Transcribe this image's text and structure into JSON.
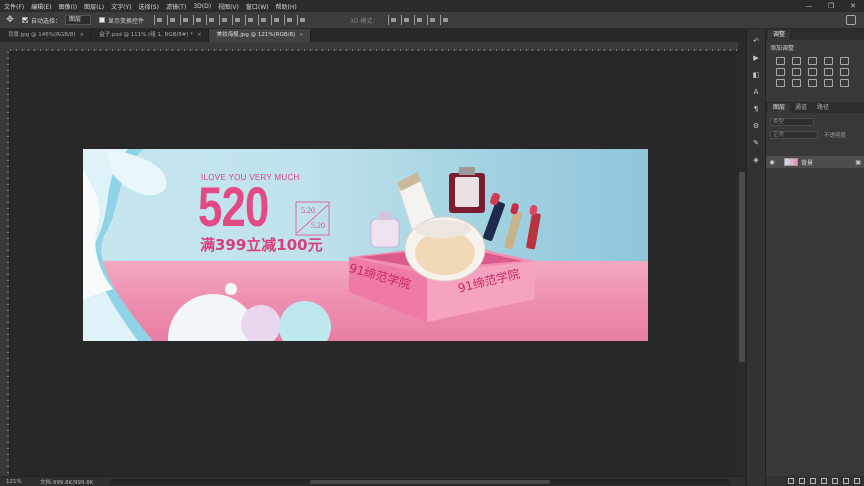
{
  "menu": [
    "文件(F)",
    "编辑(E)",
    "图像(I)",
    "图层(L)",
    "文字(Y)",
    "选择(S)",
    "滤镜(T)",
    "3D(D)",
    "视图(V)",
    "窗口(W)",
    "帮助(H)"
  ],
  "options": {
    "auto_select_label": "自动选择：",
    "auto_select_value": "图层",
    "show_transform_label": "显示变换控件",
    "mode_3d_label": "3D 模式："
  },
  "tabs": [
    {
      "label": "背景.jpg @ 146%(RGB/8)",
      "active": false
    },
    {
      "label": "盒子.psd @ 111% (组 1, RGB/8#) *",
      "active": false
    },
    {
      "label": "美妆海报.jpg @ 121%(RGB/8)",
      "active": true
    }
  ],
  "status": {
    "zoom": "121%",
    "doc": "文档:999.8K/999.8K"
  },
  "banner": {
    "tagline": "ILOVE YOU VERY MUCH",
    "big_number": "520",
    "date_top": "5.20",
    "date_bottom": "5.20",
    "promo": "满399立减100元",
    "brand_left": "91缔范学院",
    "brand_right": "91缔范学院"
  },
  "panels": {
    "adjust_tab": "调整",
    "adjust_title": "添加调整",
    "layers_tabs": [
      "图层",
      "通道",
      "路径"
    ],
    "kind_label": "类型",
    "blend_mode": "正常",
    "opacity_label": "不透明度",
    "layer_name": "背景"
  },
  "colors": {
    "accent_pink": "#e34a84",
    "sky_blue": "#9fd0e0",
    "floor_pink": "#ee8fb0"
  }
}
